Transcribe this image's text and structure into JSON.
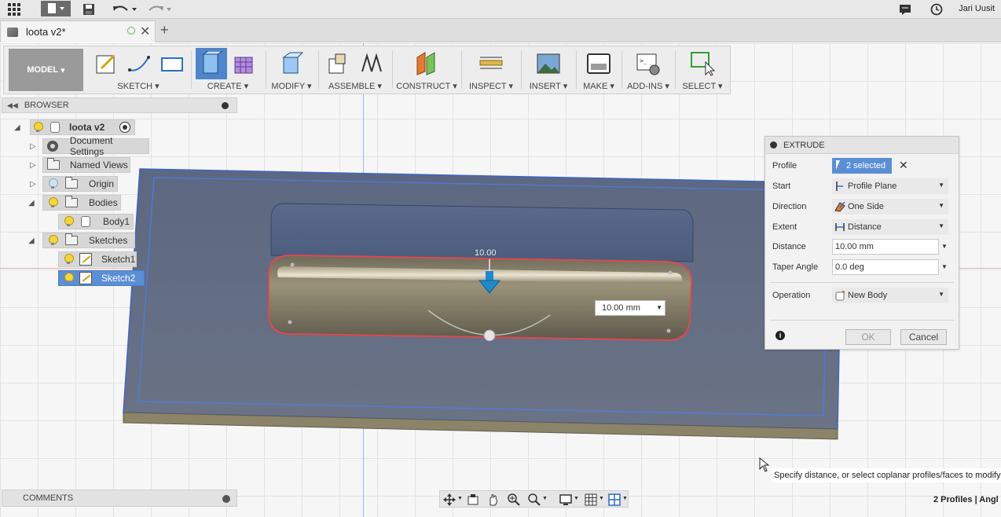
{
  "app": {
    "user": "Jari Uusit",
    "document_title": "loota v2*"
  },
  "toolbar": {
    "workspace": "MODEL",
    "groups": [
      "SKETCH",
      "CREATE",
      "MODIFY",
      "ASSEMBLE",
      "CONSTRUCT",
      "INSPECT",
      "INSERT",
      "MAKE",
      "ADD-INS",
      "SELECT"
    ]
  },
  "browser": {
    "title": "BROWSER",
    "root": "loota v2",
    "items": {
      "document_settings": "Document Settings",
      "named_views": "Named Views",
      "origin": "Origin",
      "bodies": "Bodies",
      "body1": "Body1",
      "sketches": "Sketches",
      "sketch1": "Sketch1",
      "sketch2": "Sketch2"
    }
  },
  "extrude": {
    "title": "EXTRUDE",
    "profile_label": "Profile",
    "profile_value": "2 selected",
    "start_label": "Start",
    "start_value": "Profile Plane",
    "direction_label": "Direction",
    "direction_value": "One Side",
    "extent_label": "Extent",
    "extent_value": "Distance",
    "distance_label": "Distance",
    "distance_value": "10.00 mm",
    "taper_label": "Taper Angle",
    "taper_value": "0.0 deg",
    "operation_label": "Operation",
    "operation_value": "New Body",
    "ok": "OK",
    "cancel": "Cancel"
  },
  "viewport": {
    "dimension_label": "10.00",
    "dimension_input": "10.00 mm"
  },
  "tooltip": "Specify distance, or select coplanar profiles/faces to modify",
  "comments": {
    "title": "COMMENTS"
  },
  "status": "2 Profiles | Angl",
  "colors": {
    "selection_blue": "#5a8fd6",
    "profile_red": "#e0484f",
    "body_gold": "#8a8168",
    "plate_blue_overlay": "#4a63a8"
  }
}
